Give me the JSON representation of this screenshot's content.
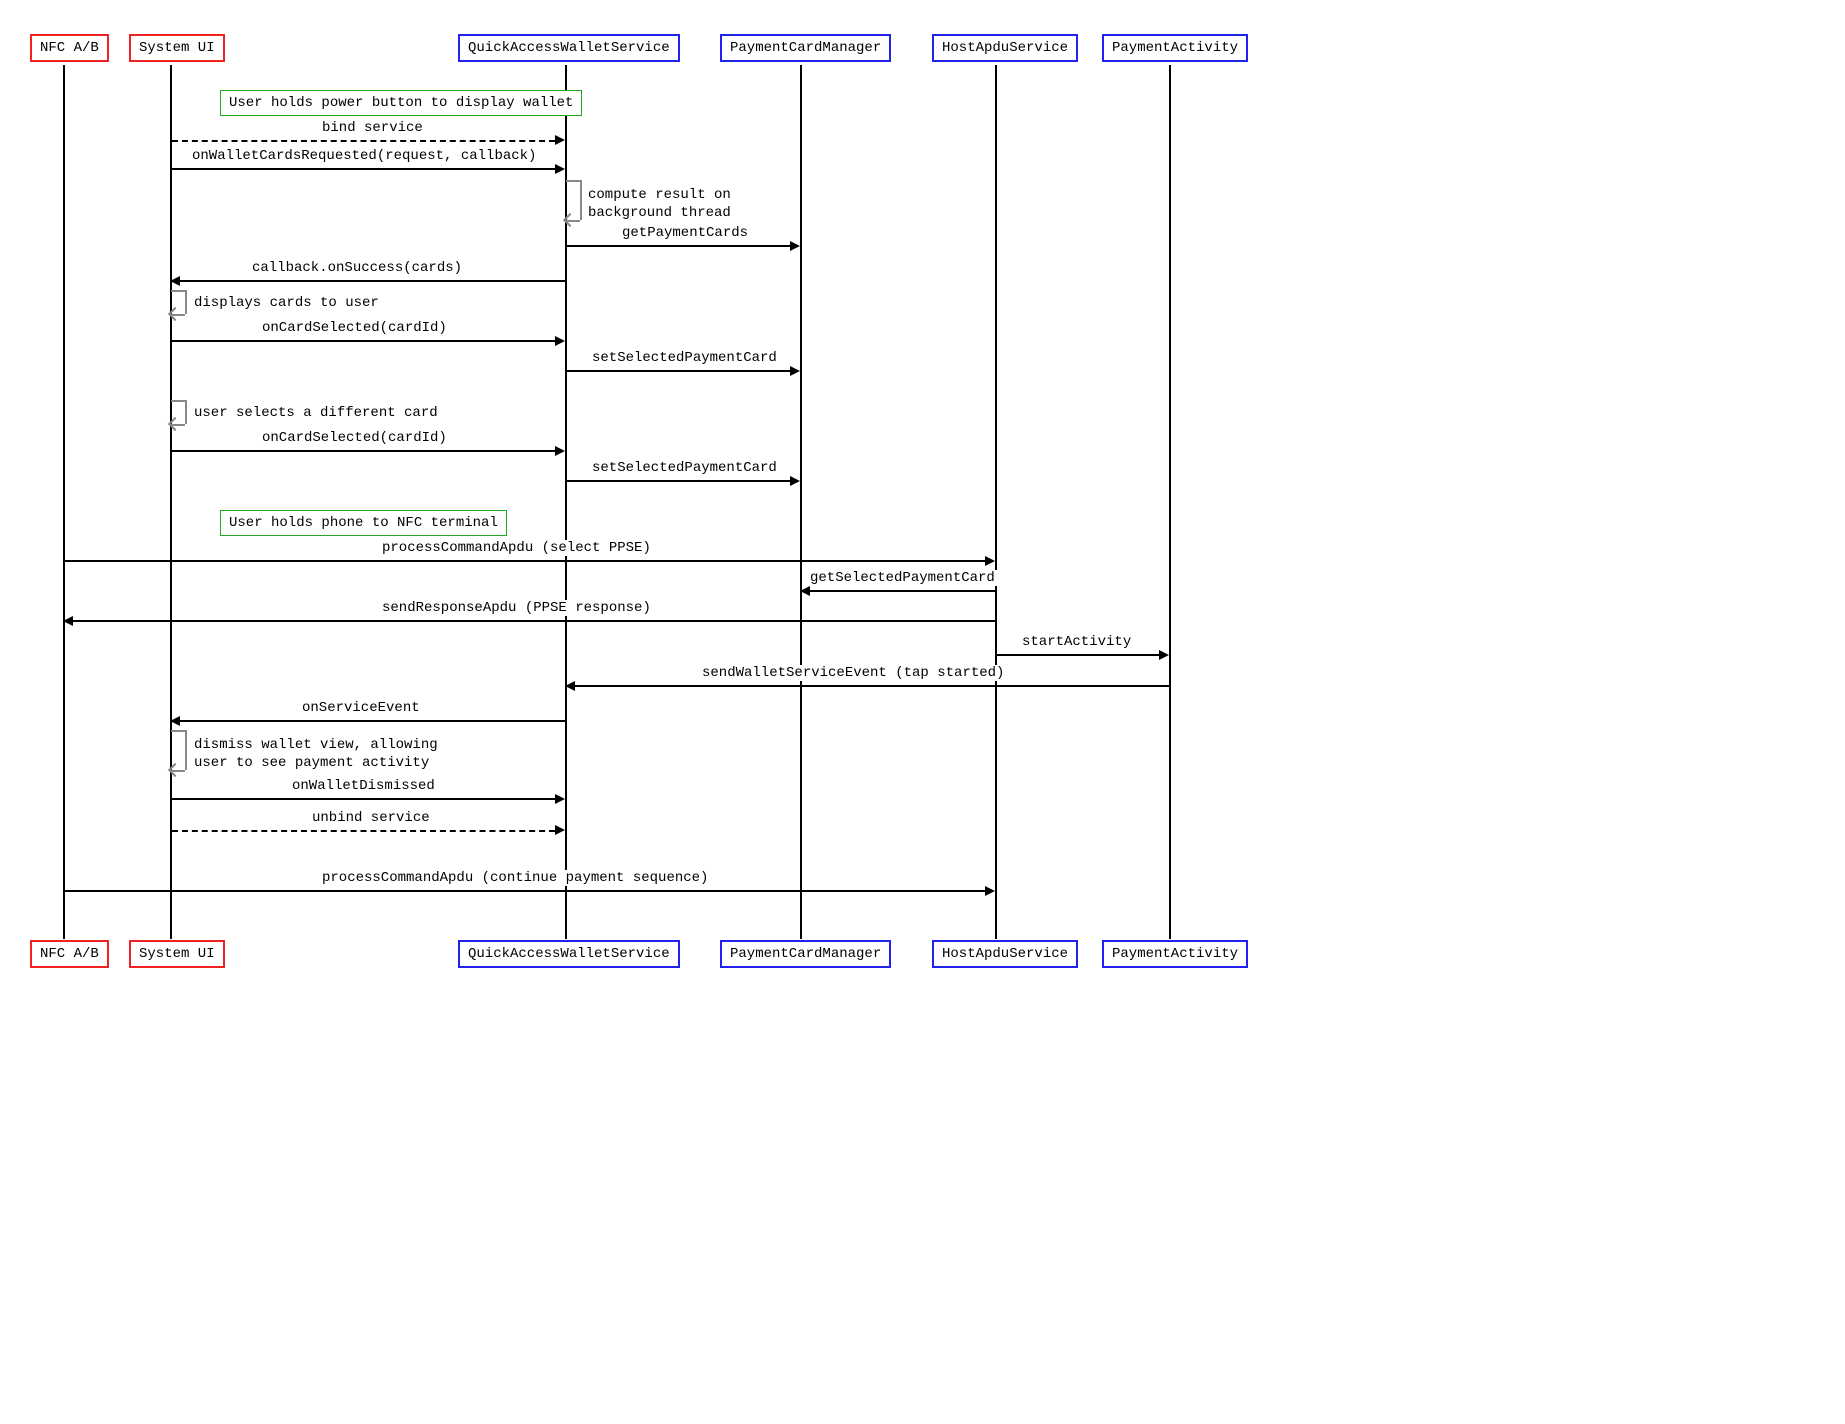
{
  "actors": {
    "nfc": "NFC A/B",
    "sysui": "System UI",
    "qaws": "QuickAccessWalletService",
    "pcm": "PaymentCardManager",
    "has": "HostApduService",
    "pa": "PaymentActivity"
  },
  "notes": {
    "hold_power": "User holds power button to display wallet",
    "hold_nfc": "User holds phone to NFC terminal"
  },
  "messages": {
    "bind": "bind service",
    "onWalletCardsRequested": "onWalletCardsRequested(request, callback)",
    "compute_bg": "compute result on\nbackground thread",
    "getPaymentCards": "getPaymentCards",
    "cb_onSuccess": "callback.onSuccess(cards)",
    "displays_cards": "displays cards to user",
    "onCardSelected": "onCardSelected(cardId)",
    "setSelectedPaymentCard": "setSelectedPaymentCard",
    "user_selects_diff": "user selects a different card",
    "processCommandApdu_ppse": "processCommandApdu (select PPSE)",
    "getSelectedPaymentCard": "getSelectedPaymentCard",
    "sendResponseApdu": "sendResponseApdu (PPSE response)",
    "startActivity": "startActivity",
    "sendWalletServiceEvent": "sendWalletServiceEvent (tap started)",
    "onServiceEvent": "onServiceEvent",
    "dismiss_wallet": "dismiss wallet view, allowing\nuser to see payment activity",
    "onWalletDismissed": "onWalletDismissed",
    "unbind": "unbind service",
    "processCommandApdu_cont": "processCommandApdu (continue payment sequence)"
  }
}
